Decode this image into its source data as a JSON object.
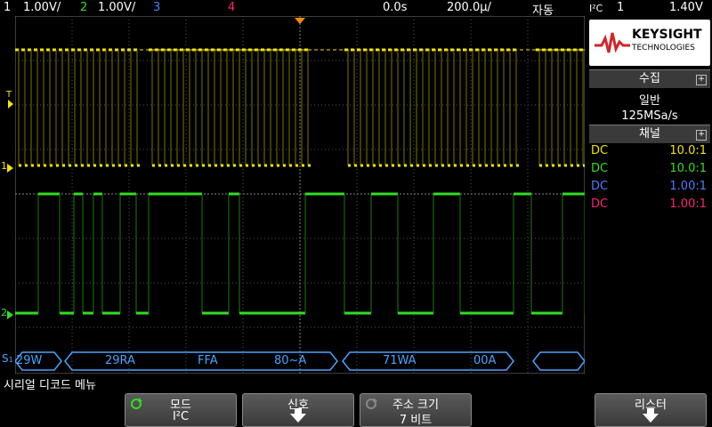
{
  "topbar": {
    "ch1_num": "1",
    "ch1_scale": "1.00V/",
    "ch2_num": "2",
    "ch2_scale": "1.00V/",
    "ch3_num": "3",
    "ch4_num": "4",
    "time_pos": "0.0s",
    "time_scale": "200.0µ/",
    "trigger_mode": "자동",
    "trigger_type": "I²C",
    "trigger_ch": "1",
    "trigger_level": "1.40V"
  },
  "markers": {
    "trigger_t": "T",
    "ch1": "1",
    "ch2": "2",
    "bus": "S",
    "bus_sub": "1"
  },
  "bus": {
    "packets": [
      "29W",
      "29RA",
      "FFA",
      "80~A",
      "71WA",
      "00A"
    ]
  },
  "panel": {
    "brand": "KEYSIGHT",
    "brand_sub": "TECHNOLOGIES",
    "acq_header": "수집",
    "acq_mode": "일반",
    "acq_rate": "125MSa/s",
    "chan_header": "채널",
    "channels": [
      {
        "coupling": "DC",
        "probe": "10.0:1",
        "color": "#f2e600"
      },
      {
        "coupling": "DC",
        "probe": "10.0:1",
        "color": "#33dd22"
      },
      {
        "coupling": "DC",
        "probe": "1.00:1",
        "color": "#4f7cff"
      },
      {
        "coupling": "DC",
        "probe": "1.00:1",
        "color": "#ff2277"
      }
    ],
    "plus_icon": "+"
  },
  "menu": {
    "title": "시리얼 디코드 메뉴",
    "keys": [
      {
        "label": "모드",
        "value": "I²C"
      },
      {
        "label": "신호",
        "value": ""
      },
      {
        "label": "주소 크기",
        "value": "7 비트"
      },
      {
        "label": "리스터",
        "value": ""
      }
    ]
  },
  "colors": {
    "ch1": "#f2e600",
    "ch2": "#33dd22",
    "ch3": "#4f7cff",
    "ch4": "#ff2277",
    "bus": "#4aa3ff",
    "trigger": "#ff8c00",
    "grid": "#555555"
  }
}
